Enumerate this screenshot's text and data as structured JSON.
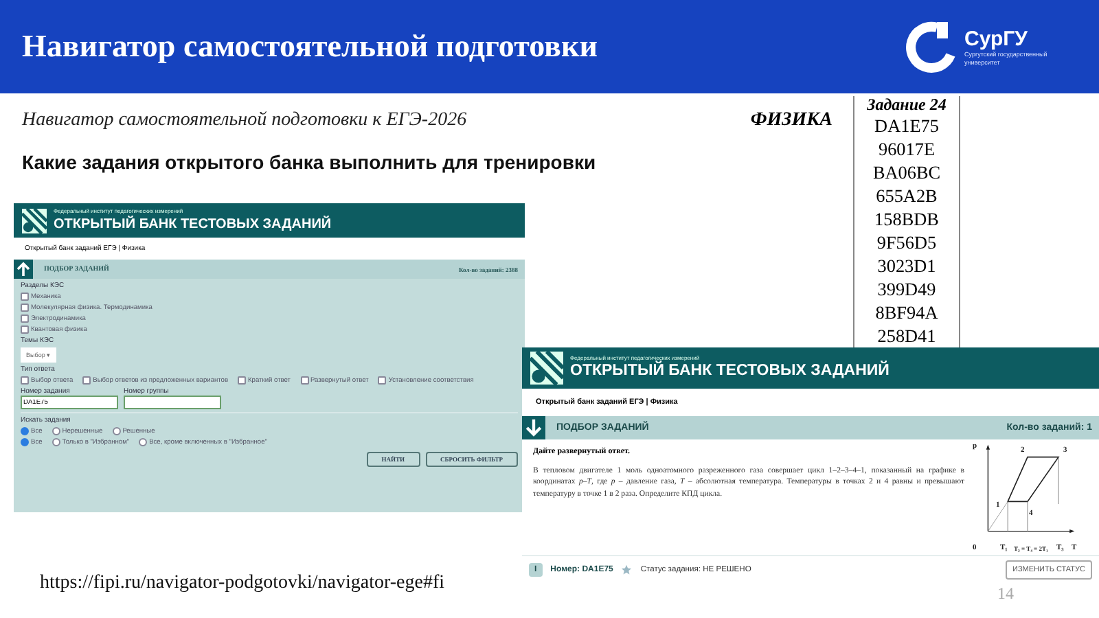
{
  "slide": {
    "title": "Навигатор самостоятельной подготовки",
    "logo_name": "СурГУ",
    "logo_caption": "Сургутский государственный университет",
    "subtitle": "Навигатор самостоятельной подготовки к ЕГЭ-2026",
    "subject": "ФИЗИКА",
    "heading": "Какие задания открытого банка выполнить для тренировки",
    "url": "https://fipi.ru/navigator-podgotovki/navigator-ege#fi",
    "page_number": "14"
  },
  "codes_table": {
    "header": "Задание 24",
    "codes": [
      "DA1E75",
      "96017E",
      "BA06BC",
      "655A2B",
      "158BDB",
      "9F56D5",
      "3023D1",
      "399D49",
      "8BF94A",
      "258D41"
    ]
  },
  "filter_screen": {
    "org": "Федеральный институт педагогических измерений",
    "bank_title": "ОТКРЫТЫЙ БАНК ТЕСТОВЫХ ЗАДАНИЙ",
    "breadcrumb": "Открытый банк заданий ЕГЭ | Физика",
    "bar_title": "ПОДБОР ЗАДАНИЙ",
    "count": "Кол-во заданий: 2388",
    "sections_label": "Разделы КЭС",
    "sections": [
      {
        "label": "Механика",
        "checked": false
      },
      {
        "label": "Молекулярная физика. Термодинамика",
        "checked": false
      },
      {
        "label": "Электродинамика",
        "checked": false
      },
      {
        "label": "Квантовая физика",
        "checked": false
      }
    ],
    "topics_label": "Темы КЭС",
    "topics_dropdown": "Выбор ▾",
    "answer_type_label": "Тип ответа",
    "answer_types": [
      {
        "label": "Выбор ответа",
        "checked": false
      },
      {
        "label": "Выбор ответов из предложенных вариантов",
        "checked": false
      },
      {
        "label": "Краткий ответ",
        "checked": false
      },
      {
        "label": "Развернутый ответ",
        "checked": false
      },
      {
        "label": "Установление соответствия",
        "checked": false
      }
    ],
    "task_number_label": "Номер задания",
    "task_number_value": "DA1E75",
    "group_number_label": "Номер группы",
    "search_label": "Искать задания",
    "search_status": [
      {
        "label": "Все",
        "selected": true
      },
      {
        "label": "Нерешенные",
        "selected": false
      },
      {
        "label": "Решенные",
        "selected": false
      }
    ],
    "search_favorites": [
      {
        "label": "Все",
        "selected": true
      },
      {
        "label": "Только в \"Избранном\"",
        "selected": false
      },
      {
        "label": "Все, кроме включенных в \"Избранное\"",
        "selected": false
      }
    ],
    "buttons": [
      "НАЙТИ",
      "СБРОСИТЬ ФИЛЬТР"
    ]
  },
  "task_screen": {
    "org": "Федеральный институт педагогических измерений",
    "bank_title": "ОТКРЫТЫЙ БАНК ТЕСТОВЫХ ЗАДАНИЙ",
    "breadcrumb": "Открытый банк заданий ЕГЭ | Физика",
    "bar_title": "ПОДБОР ЗАДАНИЙ",
    "count": "Кол-во заданий: 1",
    "instruction": "Дайте развернутый ответ.",
    "text": "В тепловом двигателе 1 моль одноатомного разреженного газа совершает цикл 1–2–3–4–1, показанный на графике в координатах *p*–*T*, где *p* – давление газа, *T* – абсолютная температура. Температуры в точках 2 и 4 равны и превышают температуру в точке 1 в 2 раза. Определите КПД цикла.",
    "graph_labels": {
      "y_axis": "p",
      "x_axis": "T",
      "origin": "0",
      "points": [
        "1",
        "2",
        "3",
        "4"
      ],
      "ticks": [
        "T₁",
        "T₂ = T₄ = 2T₁",
        "T₃"
      ]
    },
    "badge": "I",
    "number": "Номер: DA1E75",
    "favorite": false,
    "status": "Статус задания: НЕ РЕШЕНО",
    "change_button": "ИЗМЕНИТЬ СТАТУС"
  }
}
